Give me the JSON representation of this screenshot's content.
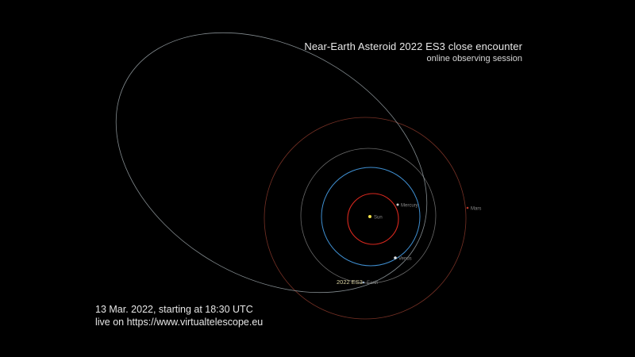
{
  "header": {
    "title": "Near-Earth Asteroid 2022 ES3 close encounter",
    "subtitle": "online observing session"
  },
  "footer": {
    "date_line": "13 Mar. 2022, starting at 18:30 UTC",
    "url_line": "live on https://www.virtualtelescope.eu"
  },
  "bodies": {
    "sun": "Sun",
    "mercury": "Mercury",
    "venus": "Venus",
    "earth": "Earth",
    "mars": "Mars",
    "asteroid": "2022 ES3"
  },
  "colors": {
    "background": "#000000",
    "sun": "#f3e24a",
    "mercury_orbit": "#d9281e",
    "venus_orbit": "#3f8fd1",
    "earth_orbit": "#6a6a6a",
    "mars_orbit": "#8c3a2c",
    "asteroid_orbit": "#9aa3a8",
    "label": "#8a8a8a"
  }
}
